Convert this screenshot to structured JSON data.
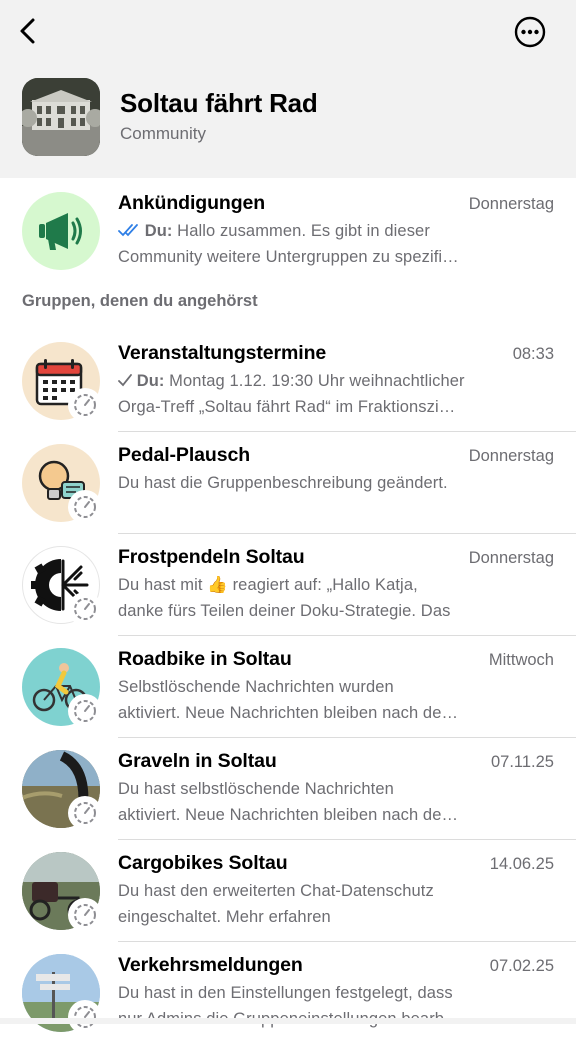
{
  "community": {
    "title": "Soltau fährt Rad",
    "subtitle": "Community"
  },
  "announcements": {
    "name": "Ankündigungen",
    "time": "Donnerstag",
    "sender": "Du:",
    "line1": "Hallo zusammen. Es gibt in dieser",
    "line2": "Community weitere Untergruppen zu spezifi…"
  },
  "section_label": "Gruppen, denen du angehörst",
  "groups": [
    {
      "name": "Veranstaltungstermine",
      "time": "08:33",
      "sender": "Du:",
      "line1": "Montag 1.12. 19:30 Uhr weihnachtlicher",
      "line2": "Orga-Treff „Soltau fährt Rad“ im Fraktionszi…"
    },
    {
      "name": "Pedal-Plausch",
      "time": "Donnerstag",
      "line1": "Du hast die Gruppenbeschreibung geändert.",
      "line2": ""
    },
    {
      "name": "Frostpendeln Soltau",
      "time": "Donnerstag",
      "line1_pre": "Du hast mit",
      "line1_emoji": "👍",
      "line1_post": "reagiert auf: „Hallo Katja,",
      "line2": "danke fürs Teilen deiner Doku-Strategie. Das"
    },
    {
      "name": "Roadbike in Soltau",
      "time": "Mittwoch",
      "line1": "Selbstlöschende Nachrichten wurden",
      "line2": "aktiviert. Neue Nachrichten bleiben nach de…"
    },
    {
      "name": "Graveln in Soltau",
      "time": "07.11.25",
      "line1": "Du hast selbstlöschende Nachrichten",
      "line2": "aktiviert. Neue Nachrichten bleiben nach de…"
    },
    {
      "name": "Cargobikes Soltau",
      "time": "14.06.25",
      "line1": "Du hast den erweiterten Chat-Datenschutz",
      "line2": "eingeschaltet. Mehr erfahren"
    },
    {
      "name": "Verkehrsmeldungen",
      "time": "07.02.25",
      "line1": "Du hast in den Einstellungen festgelegt, dass",
      "line2": "nur Admins die Gruppeneinstellungen bearb…"
    }
  ],
  "icons": {
    "back": "chevron-left-icon",
    "more": "ellipsis-circle-icon",
    "announce": "megaphone-icon",
    "disappearing": "timer-icon",
    "delivered": "double-check-icon",
    "sent": "single-check-icon"
  },
  "colors": {
    "header_bg": "#f2f2f2",
    "read_ticks": "#2f7fe6",
    "announce_bg": "#d6f8cf",
    "announce_fg": "#1f7a4a",
    "secondary_text": "#6d6d72"
  }
}
